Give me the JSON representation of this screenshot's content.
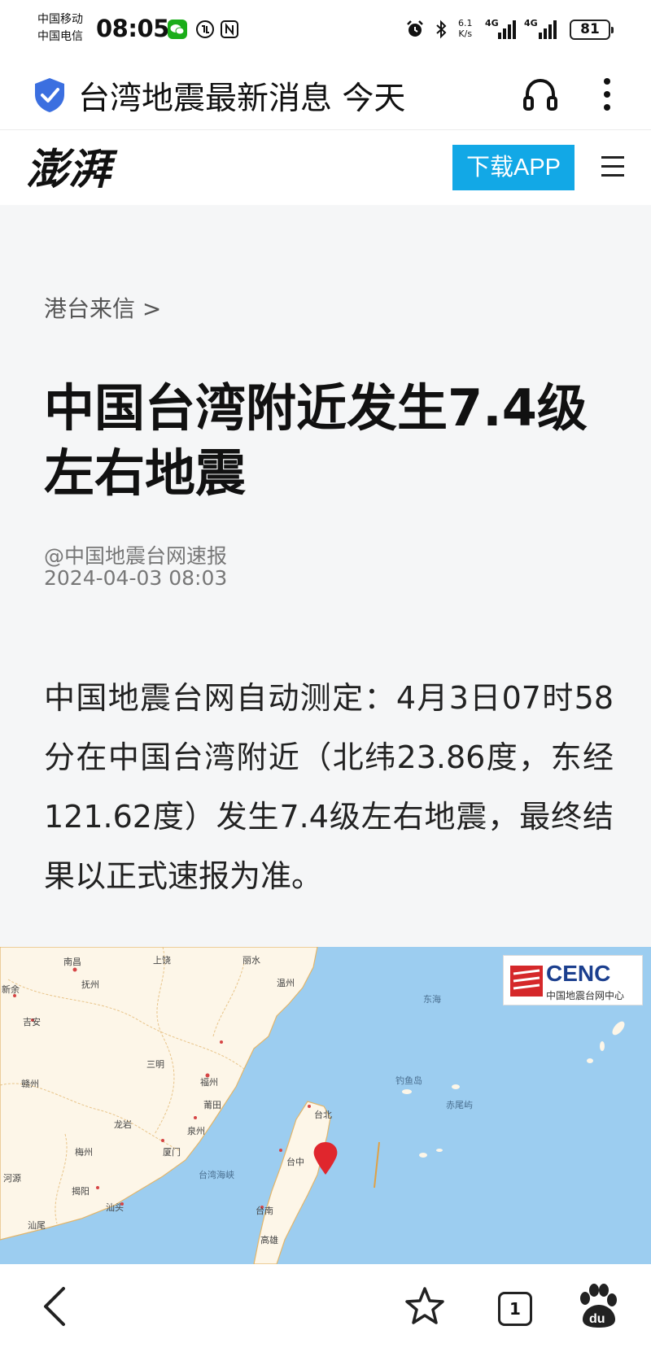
{
  "status_bar": {
    "carrier_1": "中国移动",
    "carrier_2": "中国电信",
    "time": "08:05",
    "net_speed_value": "6.1",
    "net_speed_unit": "K/s",
    "signal_1_label": "4G",
    "signal_2_label": "4G",
    "battery": "81",
    "icons": [
      "wechat-icon",
      "phone-call-icon",
      "nfc-icon",
      "alarm-icon",
      "bluetooth-icon"
    ]
  },
  "title_bar": {
    "title": "台湾地震最新消息 今天",
    "shield_color": "#3b6fe0"
  },
  "site_header": {
    "logo_text": "澎湃",
    "download_label": "下载APP",
    "download_color": "#12a8e6"
  },
  "article": {
    "breadcrumb": "港台来信 >",
    "headline_line1": "中国台湾附近发生7.4级",
    "headline_line2": "左右地震",
    "source": "@中国地震台网速报",
    "date": "2024-04-03 08:03",
    "body": "中国地震台网自动测定：4月3日07时58分在中国台湾附近（北纬23.86度，东经121.62度）发生7.4级左右地震，最终结果以正式速报为准。"
  },
  "map": {
    "logo_name": "CENC",
    "logo_sub": "中国地震台网中心",
    "labels": {
      "nanchang": "南昌",
      "shangrao": "上饶",
      "lishui": "丽水",
      "fuzhou_jx": "抚州",
      "xinyu": "新余",
      "wenzhou": "温州",
      "donghai": "东海",
      "jian": "吉安",
      "sanming": "三明",
      "fuzhou": "福州",
      "diaoyu": "钓鱼岛",
      "chiwei": "赤尾屿",
      "ganzhou": "赣州",
      "putian": "莆田",
      "longyan": "龙岩",
      "quanzhou": "泉州",
      "taibei": "台北",
      "meizhou": "梅州",
      "xiamen": "厦门",
      "taizhong": "台中",
      "strait": "台湾海峡",
      "heyuan": "河源",
      "jieyang": "揭阳",
      "shantou": "汕头",
      "tainan": "台南",
      "shanwei": "汕尾",
      "gaoxiong": "高雄"
    },
    "marker_color": "#e0262d",
    "sea_color": "#9ccdf0",
    "land_color": "#fdf6e8"
  },
  "bottom_nav": {
    "tab_count": "1",
    "icons": [
      "back-arrow-icon",
      "star-icon",
      "tabs-icon",
      "baidu-paw-icon"
    ]
  }
}
